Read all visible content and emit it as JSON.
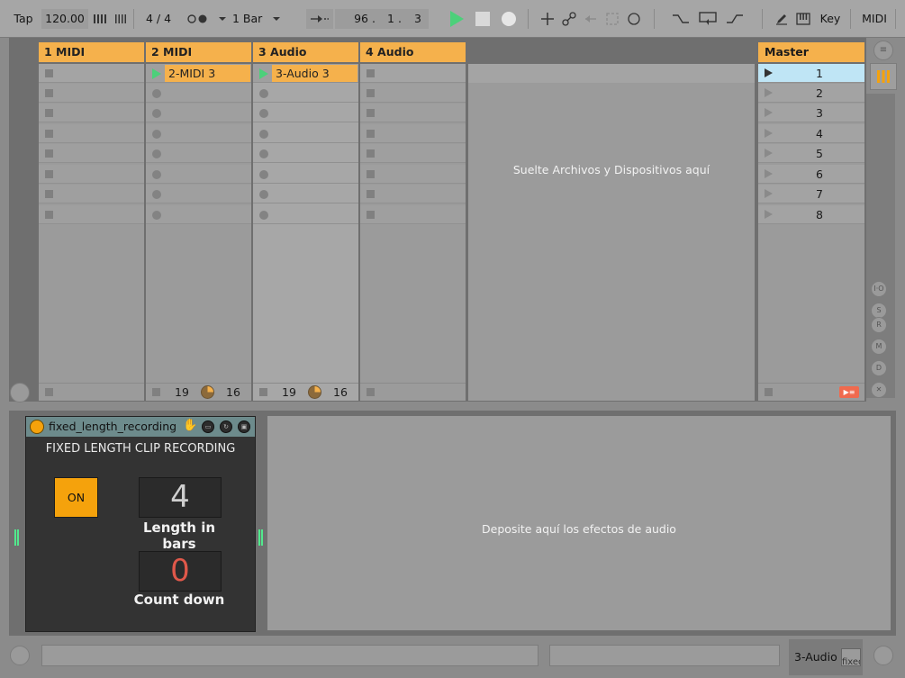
{
  "transport": {
    "tap": "Tap",
    "tempo": "120.00",
    "signature": "4 / 4",
    "quantize": "1 Bar",
    "position": [
      "96 .",
      "1 .",
      "3"
    ],
    "key": "Key",
    "midi": "MIDI"
  },
  "tracks": [
    {
      "name": "1 MIDI",
      "type": "midi",
      "clip": "",
      "playing": false
    },
    {
      "name": "2 MIDI",
      "type": "midi",
      "clip": "2-MIDI 3",
      "playing": true,
      "footer": {
        "left": "19",
        "right": "16"
      }
    },
    {
      "name": "3 Audio",
      "type": "audio",
      "clip": "3-Audio 3",
      "playing": true,
      "footer": {
        "left": "19",
        "right": "16"
      }
    },
    {
      "name": "4 Audio",
      "type": "audio",
      "clip": "",
      "playing": false
    }
  ],
  "dropzone": {
    "text": "Suelte Archivos y Dispositivos aquí"
  },
  "master": {
    "name": "Master",
    "scenes": [
      "1",
      "2",
      "3",
      "4",
      "5",
      "6",
      "7",
      "8"
    ],
    "selected_scene": 0
  },
  "side_buttons": [
    "I·O",
    "S",
    "R",
    "M",
    "D",
    "✕"
  ],
  "device": {
    "name": "fixed_length_recording",
    "title": "FIXED LENGTH CLIP RECORDING",
    "on_label": "ON",
    "length_value": "4",
    "length_label": "Length in bars",
    "countdown_value": "0",
    "countdown_label": "Count down"
  },
  "fxzone": {
    "text": "Deposite aquí los efectos de audio"
  },
  "status": {
    "track_label": "3-Audio",
    "mini_label": "fixed"
  },
  "colors": {
    "track_orange": "#f5b14c",
    "play_green": "#4cd07a",
    "device_orange": "#f5a20c",
    "scene_selected": "#bfe5f5"
  }
}
